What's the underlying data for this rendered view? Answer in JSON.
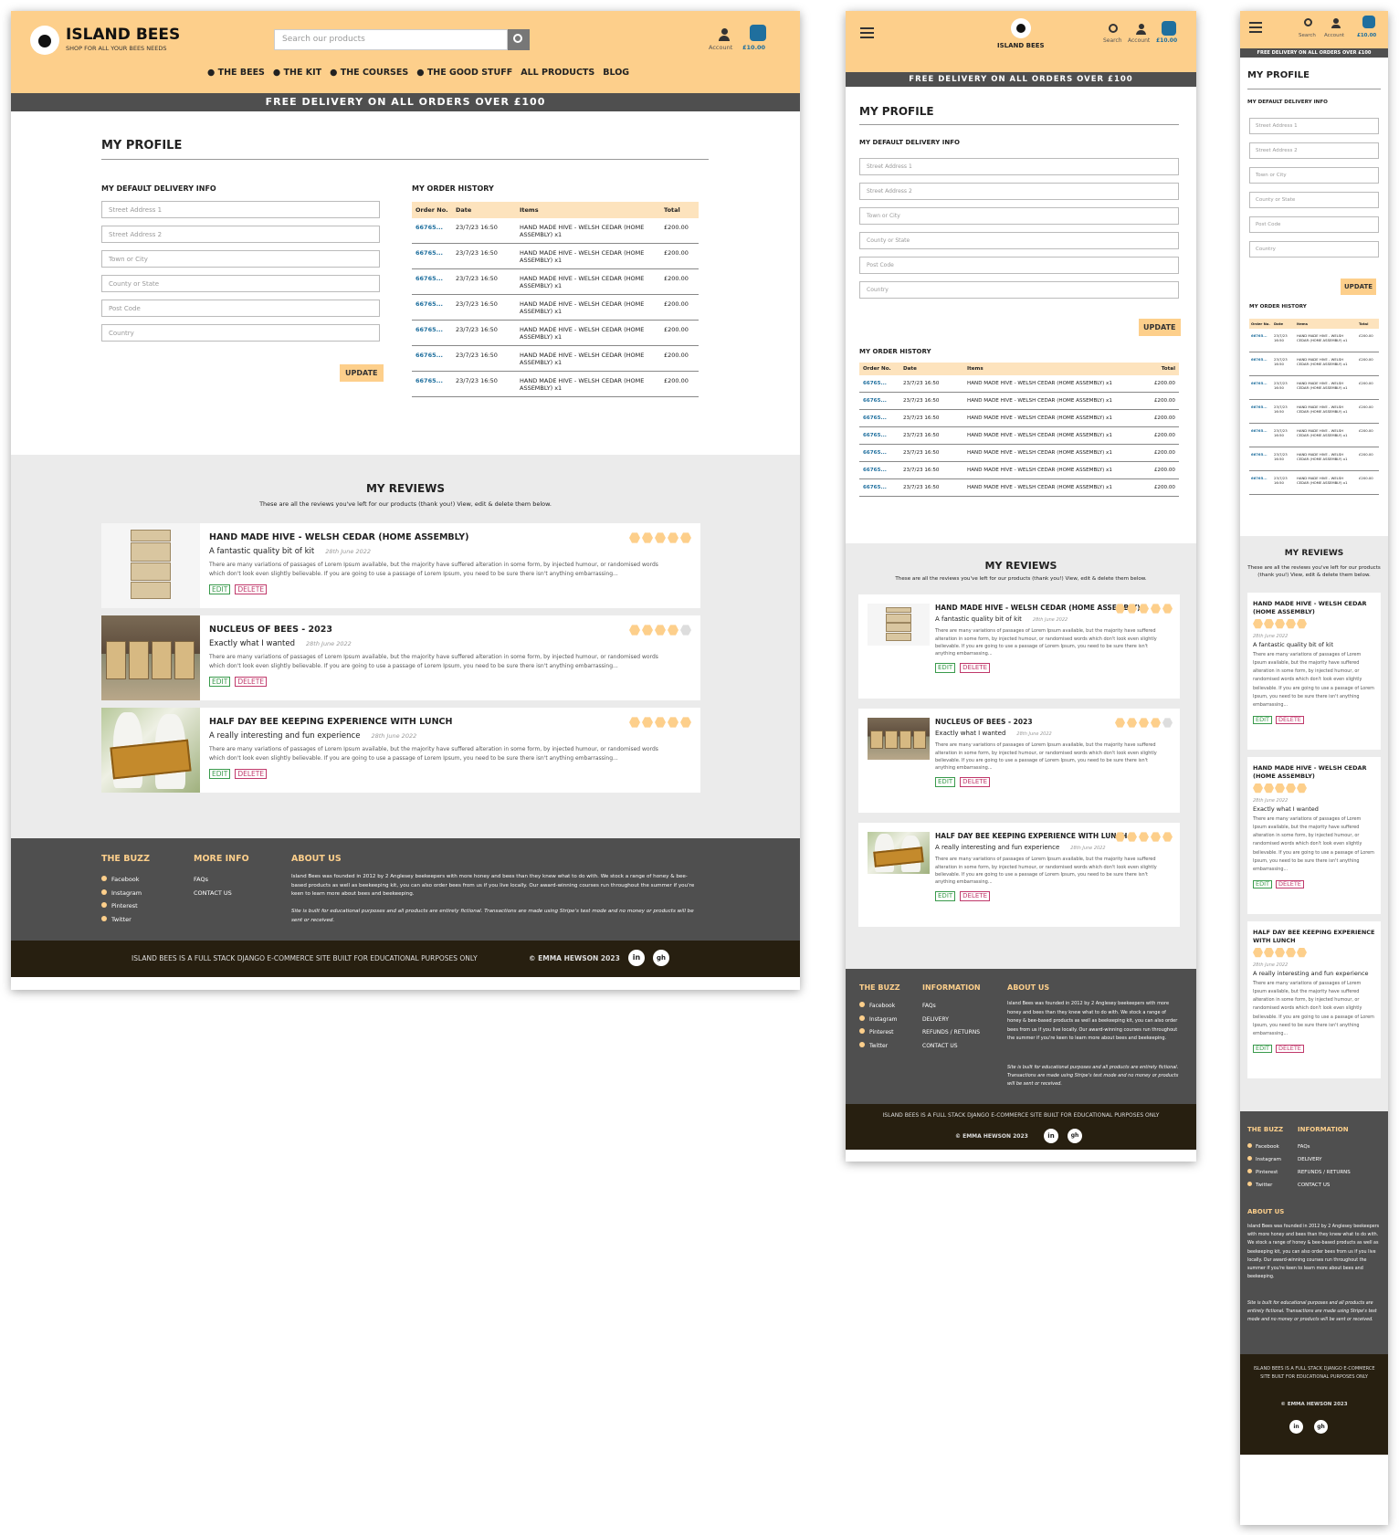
{
  "brand": {
    "name": "ISLAND BEES",
    "tagline": "SHOP FOR ALL YOUR BEES NEEDS"
  },
  "search": {
    "placeholder": "Search our products",
    "label": "Search"
  },
  "account": {
    "label": "Account"
  },
  "basket": {
    "total": "£10.00"
  },
  "nav": [
    "THE BEES",
    "THE KIT",
    "THE COURSES",
    "THE GOOD STUFF",
    "ALL PRODUCTS",
    "BLOG"
  ],
  "banner": "FREE DELIVERY ON ALL ORDERS OVER £100",
  "profile": {
    "title": "MY PROFILE",
    "delivery_heading": "MY DEFAULT DELIVERY INFO",
    "fields": [
      "Street Address 1",
      "Street Address 2",
      "Town or City",
      "County or State",
      "Post Code",
      "Country"
    ],
    "update": "UPDATE"
  },
  "orders": {
    "heading": "MY ORDER HISTORY",
    "columns": [
      "Order No.",
      "Date",
      "Items",
      "Total"
    ],
    "mobile_columns": [
      "Order No.",
      "Date",
      "Items",
      "Total"
    ],
    "rows": [
      {
        "no": "66765...",
        "date": "23/7/23 16:50",
        "items": "HAND MADE HIVE - WELSH CEDAR (HOME ASSEMBLY) x1",
        "total": "£200.00"
      },
      {
        "no": "66765...",
        "date": "23/7/23 16:50",
        "items": "HAND MADE HIVE - WELSH CEDAR (HOME ASSEMBLY) x1",
        "total": "£200.00"
      },
      {
        "no": "66765...",
        "date": "23/7/23 16:50",
        "items": "HAND MADE HIVE - WELSH CEDAR (HOME ASSEMBLY) x1",
        "total": "£200.00"
      },
      {
        "no": "66765...",
        "date": "23/7/23 16:50",
        "items": "HAND MADE HIVE - WELSH CEDAR (HOME ASSEMBLY) x1",
        "total": "£200.00"
      },
      {
        "no": "66765...",
        "date": "23/7/23 16:50",
        "items": "HAND MADE HIVE - WELSH CEDAR (HOME ASSEMBLY) x1",
        "total": "£200.00"
      },
      {
        "no": "66765...",
        "date": "23/7/23 16:50",
        "items": "HAND MADE HIVE - WELSH CEDAR (HOME ASSEMBLY) x1",
        "total": "£200.00"
      },
      {
        "no": "66765...",
        "date": "23/7/23 16:50",
        "items": "HAND MADE HIVE - WELSH CEDAR (HOME ASSEMBLY) x1",
        "total": "£200.00"
      }
    ]
  },
  "reviews": {
    "title": "MY REVIEWS",
    "intro": "These are all the reviews you've left for our products (thank you!) View, edit & delete them below.",
    "edit": "EDIT",
    "delete": "DELETE",
    "body": "There are many variations of passages of Lorem Ipsum available, but the majority have suffered alteration in some form, by injected humour, or randomised words which don't look even slightly believable. If you are going to use a passage of Lorem Ipsum, you need to be sure there isn't anything embarrassing...",
    "items": [
      {
        "title": "HAND MADE HIVE - WELSH CEDAR (HOME ASSEMBLY)",
        "subtitle": "A fantastic quality bit of kit",
        "date": "28th June 2022",
        "rating": 5,
        "image": "hive"
      },
      {
        "title": "NUCLEUS OF BEES - 2023",
        "subtitle": "Exactly what I wanted",
        "date": "28th June 2022",
        "rating": 4,
        "image": "boxes"
      },
      {
        "title": "HALF DAY BEE KEEPING EXPERIENCE WITH LUNCH",
        "subtitle": "A really interesting and fun experience",
        "date": "28th June 2022",
        "rating": 5,
        "image": "beekeeper"
      }
    ],
    "mobile_items": [
      {
        "title": "HAND MADE HIVE - WELSH CEDAR (HOME ASSEMBLY)",
        "subtitle": "A fantastic quality bit of kit",
        "date": "28th June 2022",
        "rating": 5
      },
      {
        "title": "HAND MADE HIVE - WELSH CEDAR (HOME ASSEMBLY)",
        "subtitle": "Exactly what I wanted",
        "date": "28th June 2022",
        "rating": 5
      },
      {
        "title": "HALF DAY BEE KEEPING EXPERIENCE WITH LUNCH",
        "subtitle": "A really interesting and fun experience",
        "date": "28th June 2022",
        "rating": 5
      }
    ]
  },
  "footer": {
    "buzz_title": "THE BUZZ",
    "social": [
      "Facebook",
      "Instagram",
      "Pinterest",
      "Twitter"
    ],
    "more_title": "MORE INFO",
    "more_links": [
      "FAQs",
      "CONTACT US"
    ],
    "info_title": "INFORMATION",
    "info_links": [
      "FAQs",
      "DELIVERY",
      "REFUNDS / RETURNS",
      "CONTACT US"
    ],
    "about_title": "ABOUT US",
    "about_text": "Island Bees was founded in 2012 by 2 Anglesey beekeepers with more honey and bees than they knew what to do with. We stock a range of honey & bee-based products as well as beekeeping kit, you can also order bees from us if you live locally. Our award-winning courses run throughout the summer if you're keen to learn more about bees and beekeeping.",
    "disclaimer": "Site is built for educational purposes and all products are entirely fictional. Transactions are made using Stripe's test mode and no money or products will be sent or received.",
    "bottom_text": "ISLAND BEES IS A FULL STACK DJANGO E-COMMERCE SITE BUILT FOR EDUCATIONAL PURPOSES ONLY",
    "copyright": "© EMMA HEWSON 2023",
    "linkedin": "in",
    "github": "gh"
  },
  "colors": {
    "brand": "#fdcf8b",
    "dark": "#4f4f4f",
    "footer_bottom": "#271f10",
    "link": "#1f6f9e",
    "edit": "#3a9a4c",
    "delete": "#c0396b"
  },
  "icons": [
    "bee-logo-icon",
    "search-icon",
    "account-icon",
    "basket-icon",
    "menu-icon",
    "linkedin-icon",
    "github-icon"
  ]
}
